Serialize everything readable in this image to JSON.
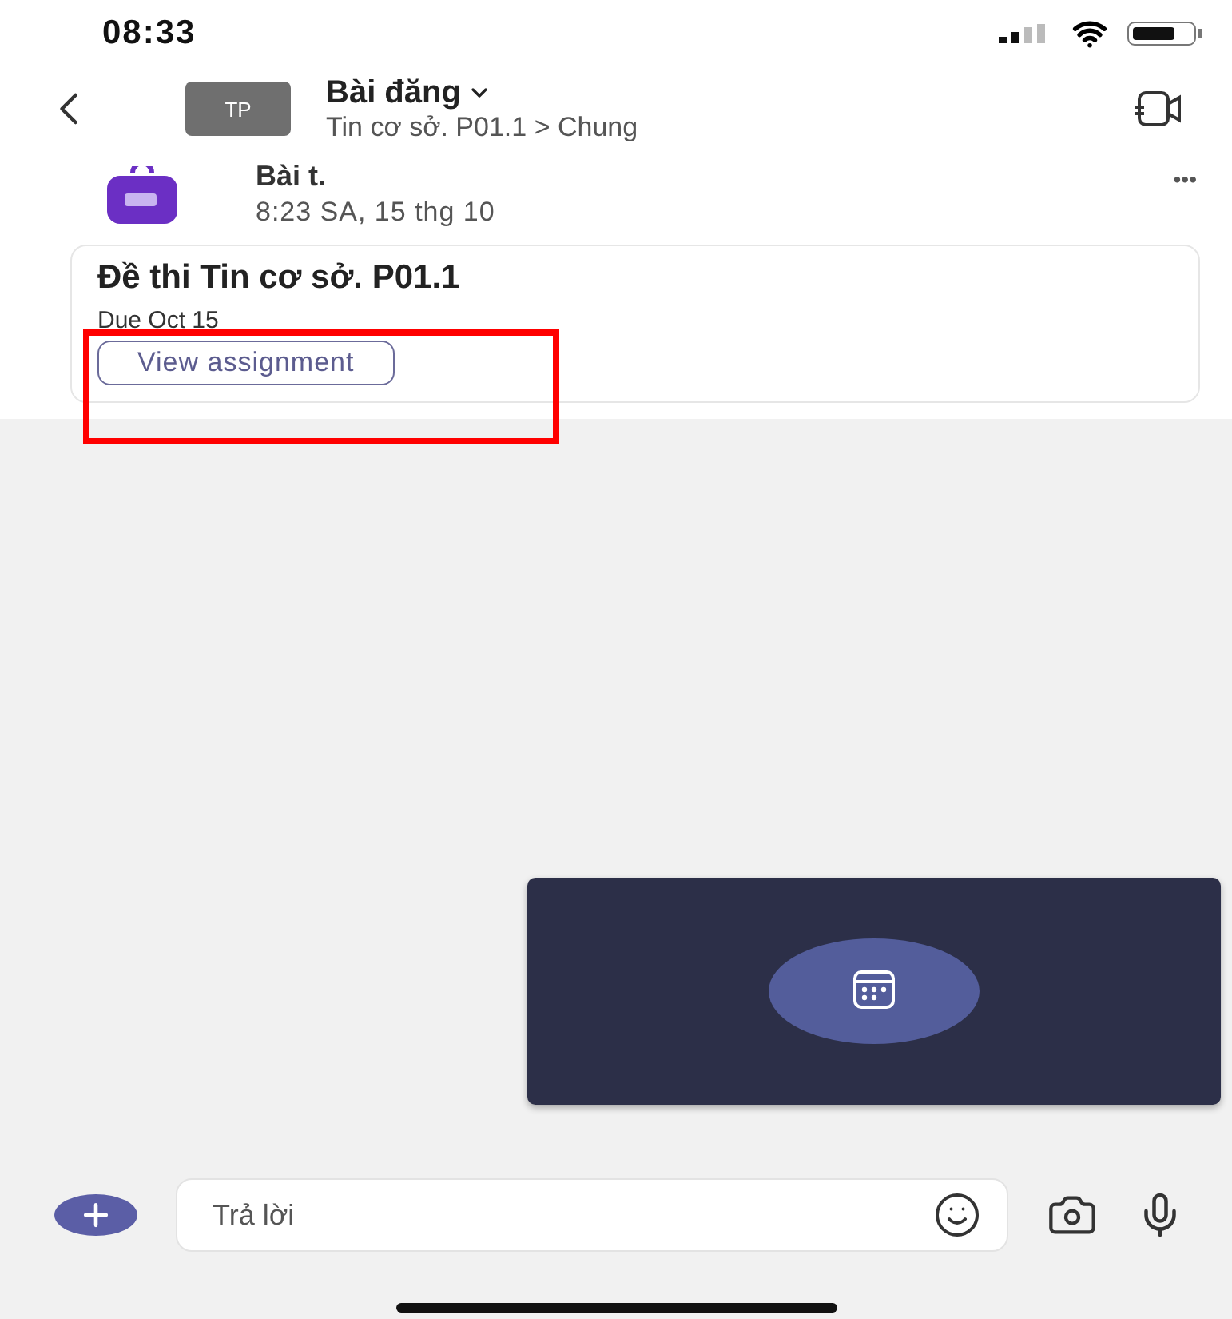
{
  "status_bar": {
    "time": "08:33"
  },
  "header": {
    "avatar": "TP",
    "title": "Bài đăng",
    "subtitle": "Tin cơ sở. P01.1 > Chung"
  },
  "post": {
    "author": "Bài t.",
    "time": "8:23 SA, 15 thg 10",
    "more": "•••"
  },
  "assignment": {
    "title": "Đề thi Tin cơ sở. P01.1",
    "due": "Due Oct 15",
    "button": "View assignment",
    "highlighted": true
  },
  "composer": {
    "placeholder": "Trả lời"
  }
}
